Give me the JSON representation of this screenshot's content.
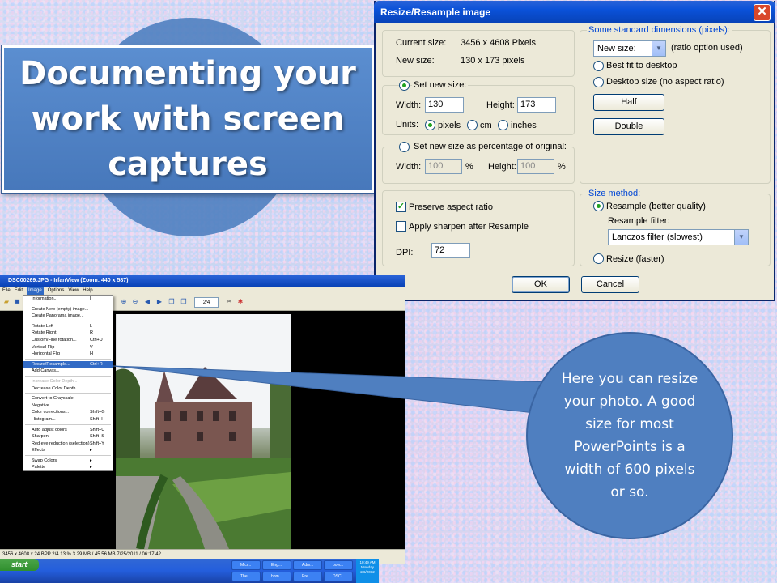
{
  "slide": {
    "title": "Documenting your work with screen captures",
    "callout": "Here you can resize your photo. A good size for most PowerPoints is a width of 600 pixels or so."
  },
  "dialog": {
    "title": "Resize/Resample image",
    "current_size_label": "Current size:",
    "current_size_value": "3456  x  4608  Pixels",
    "new_size_label": "New size:",
    "new_size_value": "130  x  173  pixels",
    "set_new_size_label": "Set new size:",
    "width_label": "Width:",
    "width_value": "130",
    "height_label": "Height:",
    "height_value": "173",
    "units_label": "Units:",
    "unit_pixels": "pixels",
    "unit_cm": "cm",
    "unit_inches": "inches",
    "set_percentage_label": "Set new size as percentage of original:",
    "pct_width_label": "Width:",
    "pct_width_value": "100",
    "pct_height_label": "Height:",
    "pct_height_value": "100",
    "pct_symbol": "%",
    "preserve_aspect_label": "Preserve aspect ratio",
    "apply_sharpen_label": "Apply sharpen after Resample",
    "dpi_label": "DPI:",
    "dpi_value": "72",
    "standard_dims_legend": "Some standard dimensions (pixels):",
    "standard_select_value": "New size:",
    "ratio_note": "(ratio option used)",
    "best_fit_label": "Best fit to desktop",
    "desktop_size_label": "Desktop size (no aspect ratio)",
    "half_button": "Half",
    "double_button": "Double",
    "size_method_legend": "Size method:",
    "resample_label": "Resample (better quality)",
    "resample_filter_label": "Resample filter:",
    "filter_select_value": "Lanczos filter (slowest)",
    "resize_label": "Resize (faster)",
    "ok_button": "OK",
    "cancel_button": "Cancel",
    "close_glyph": "✕"
  },
  "irfanview": {
    "title": "DSC00269.JPG - IrfanView (Zoom: 440 x 587)",
    "menus": [
      "File",
      "Edit",
      "Image",
      "Options",
      "View",
      "Help"
    ],
    "page_counter": "2/4",
    "status": "3456 x 4608 x 24 BPP    2/4    13 %    3.29 MB / 45.56 MB    7/25/2011 / 06:17:42",
    "image_menu": [
      {
        "label": "Information...",
        "shortcut": "I"
      },
      {
        "sep": true
      },
      {
        "label": "Create New (empty) image...",
        "shortcut": ""
      },
      {
        "label": "Create Panorama image...",
        "shortcut": ""
      },
      {
        "sep": true
      },
      {
        "label": "Rotate Left",
        "shortcut": "L"
      },
      {
        "label": "Rotate Right",
        "shortcut": "R"
      },
      {
        "label": "Custom/Fine rotation...",
        "shortcut": "Ctrl+U"
      },
      {
        "label": "Vertical Flip",
        "shortcut": "V"
      },
      {
        "label": "Horizontal Flip",
        "shortcut": "H"
      },
      {
        "sep": true
      },
      {
        "label": "Resize/Resample...",
        "shortcut": "Ctrl+R",
        "highlight": true
      },
      {
        "label": "Add Canvas...",
        "shortcut": ""
      },
      {
        "sep": true
      },
      {
        "label": "Increase Color Depth...",
        "shortcut": "",
        "disabled": true
      },
      {
        "label": "Decrease Color Depth...",
        "shortcut": ""
      },
      {
        "sep": true
      },
      {
        "label": "Convert to Grayscale",
        "shortcut": ""
      },
      {
        "label": "Negative",
        "shortcut": ""
      },
      {
        "label": "Color corrections...",
        "shortcut": "Shift+G"
      },
      {
        "label": "Histogram...",
        "shortcut": "Shift+H"
      },
      {
        "sep": true
      },
      {
        "label": "Auto adjust colors",
        "shortcut": "Shift+U"
      },
      {
        "label": "Sharpen",
        "shortcut": "Shift+S"
      },
      {
        "label": "Red eye reduction (selection)",
        "shortcut": "Shift+Y"
      },
      {
        "label": "Effects",
        "shortcut": "▸"
      },
      {
        "sep": true
      },
      {
        "label": "Swap Colors",
        "shortcut": "▸"
      },
      {
        "label": "Palette",
        "shortcut": "▸"
      }
    ]
  },
  "taskbar": {
    "start": "start",
    "tasks": [
      "Micr...",
      "Eng...",
      "Adm...",
      "pow...",
      "The...",
      "hom...",
      "Pre...",
      "DSC..."
    ],
    "clock_time": "10:49 AM",
    "clock_day": "Monday",
    "clock_date": "2/6/2012"
  },
  "colors": {
    "callout_fill": "#4f7fc0",
    "xp_titlebar": "#0a51d8",
    "xp_face": "#ece9d8"
  }
}
